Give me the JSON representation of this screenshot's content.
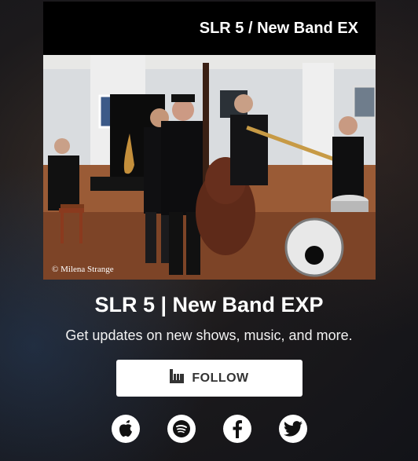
{
  "card": {
    "title": "SLR 5 / New Band EX",
    "photo_credit": "© Milena Strange"
  },
  "main": {
    "headline": "SLR 5 | New Band EXP",
    "subline": "Get updates on new shows, music, and more."
  },
  "follow_button": {
    "label": "FOLLOW",
    "icon": "bandsintown-icon"
  },
  "socials": [
    {
      "name": "apple-music",
      "icon": "apple-icon"
    },
    {
      "name": "spotify",
      "icon": "spotify-icon"
    },
    {
      "name": "facebook",
      "icon": "facebook-icon"
    },
    {
      "name": "twitter",
      "icon": "twitter-icon"
    }
  ],
  "colors": {
    "button_bg": "#ffffff",
    "button_text": "#333333",
    "title_bar_bg": "#000000"
  }
}
